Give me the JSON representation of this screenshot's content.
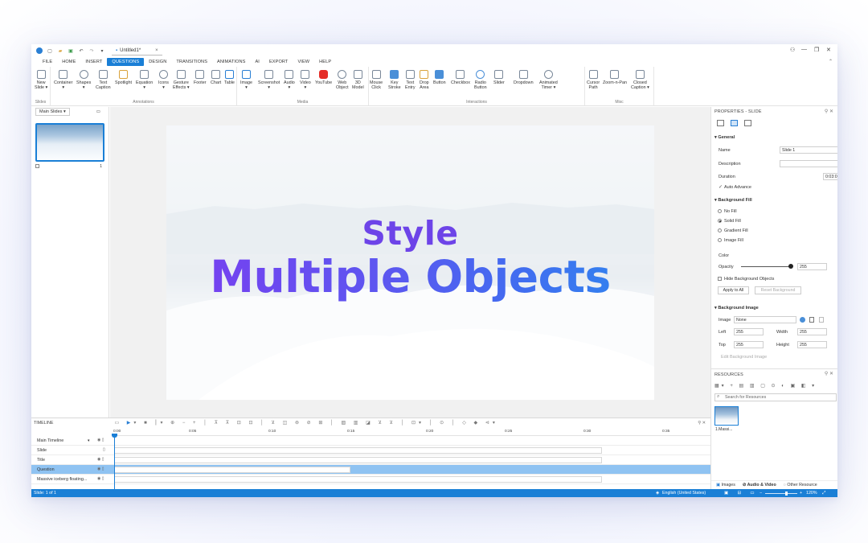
{
  "titlebar": {
    "doc_tab": "Untitled1*",
    "close_tab": "×",
    "window_controls": [
      "—",
      "❐",
      "✕"
    ]
  },
  "menu": {
    "items": [
      "FILE",
      "HOME",
      "INSERT",
      "QUESTIONS",
      "DESIGN",
      "TRANSITIONS",
      "ANIMATIONS",
      "AI",
      "EXPORT",
      "VIEW",
      "HELP"
    ],
    "active": "QUESTIONS"
  },
  "ribbon": {
    "groups": [
      {
        "label": "Slides",
        "buttons": [
          "New\nSlide ▾"
        ]
      },
      {
        "label": "Annotations",
        "buttons": [
          "Container\n▾",
          "Shapes\n▾",
          "Text\nCaption",
          "Spotlight",
          "Equation\n▾",
          "Icons\n▾",
          "Gesture\nEffects ▾",
          "Footer",
          "Chart",
          "Table"
        ]
      },
      {
        "label": "Media",
        "buttons": [
          "Image\n▾",
          "Screenshot\n▾",
          "Audio\n▾",
          "Video\n▾",
          "YouTube",
          "Web\nObject",
          "3D\nModel"
        ]
      },
      {
        "label": "Interactions",
        "buttons": [
          "Mouse\nClick",
          "Key\nStroke",
          "Text\nEntry",
          "Drop\nArea",
          "Button",
          "Checkbox",
          "Radio\nButton",
          "Slider",
          "Dropdown",
          "Animated\nTimer ▾"
        ]
      },
      {
        "label": "Misc",
        "buttons": [
          "Cursor\nPath",
          "Zoom-n-Pan",
          "Closed\nCaption ▾"
        ]
      }
    ]
  },
  "slides_panel": {
    "title": "Main Slides ▾",
    "slide_number": "1"
  },
  "slide": {
    "line1": "Style",
    "line2": "Multiple Objects"
  },
  "properties": {
    "title": "PROPERTIES - SLIDE",
    "general": {
      "heading": "General",
      "name_label": "Name",
      "name_value": "Slide 1",
      "description_label": "Description",
      "description_value": "",
      "duration_label": "Duration",
      "duration_value": "0:03:08",
      "auto_advance": "Auto Advance"
    },
    "background_fill": {
      "heading": "Background Fill",
      "options": [
        "No Fill",
        "Solid Fill",
        "Gradient Fill",
        "Image Fill"
      ],
      "selected": "Solid Fill",
      "color_label": "Color",
      "opacity_label": "Opacity",
      "opacity_value": "255",
      "opacity_level": 1.0,
      "hide_objects": "Hide Background Objects",
      "apply_all": "Apply to All",
      "reset": "Reset Background"
    },
    "background_image": {
      "heading": "Background Image",
      "image_label": "Image",
      "image_value": "None",
      "left_label": "Left",
      "left_value": "255",
      "width_label": "Width",
      "width_value": "255",
      "top_label": "Top",
      "top_value": "255",
      "height_label": "Height",
      "height_value": "255",
      "edit": "Edit Background Image"
    }
  },
  "resources": {
    "title": "RESOURCES",
    "search_placeholder": "Search for Resources",
    "item_label": "1.Massi...",
    "tabs": [
      "Images",
      "Audio & Video",
      "Other Resource"
    ],
    "active_tab": "Audio & Video"
  },
  "timeline": {
    "title": "TIMELINE",
    "ticks": [
      "0:00",
      "0:05",
      "0:10",
      "0:15",
      "0:20",
      "0:25",
      "0:30",
      "0:35"
    ],
    "rows": [
      {
        "name": "Main Timeline",
        "extra": "▾"
      },
      {
        "name": "Slide",
        "extra": ""
      },
      {
        "name": "Title",
        "extra": ""
      },
      {
        "name": "Question",
        "extra": ""
      },
      {
        "name": "Massive iceberg floating...",
        "extra": ""
      }
    ],
    "selected_row": "Question"
  },
  "statusbar": {
    "left": "Slide: 1 of 1",
    "language": "English (United States)",
    "zoom": "120%"
  }
}
